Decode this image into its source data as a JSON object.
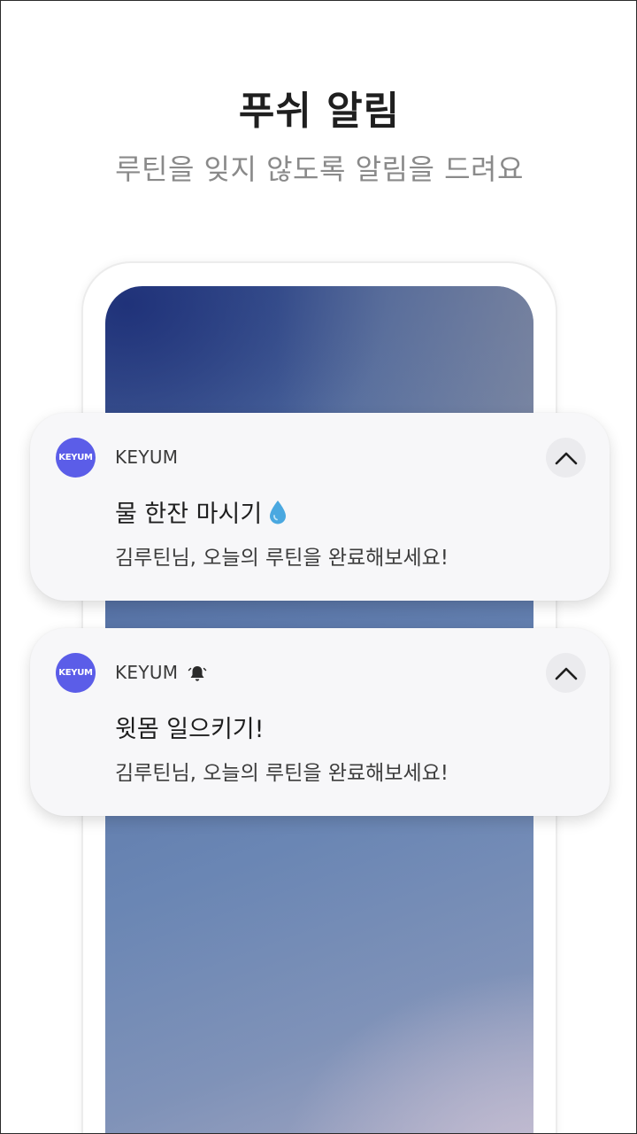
{
  "header": {
    "title": "푸쉬 알림",
    "subtitle": "루틴을 잊지 않도록 알림을 드려요"
  },
  "notifications": [
    {
      "app_icon_text": "KEYUM",
      "app_name": "KEYUM",
      "title": "물 한잔 마시기",
      "title_icon": "water-drop-icon",
      "body": "김루틴님, 오늘의 루틴을 완료해보세요!"
    },
    {
      "app_icon_text": "KEYUM",
      "app_name": "KEYUM",
      "status_icon": "bell-icon",
      "title": "윗몸 일으키기!",
      "body": "김루틴님, 오늘의 루틴을 완료해보세요!"
    }
  ],
  "colors": {
    "app_icon": "#5b5de8",
    "notification_bg": "#f7f7f9",
    "drop": "#4aa8e0"
  }
}
